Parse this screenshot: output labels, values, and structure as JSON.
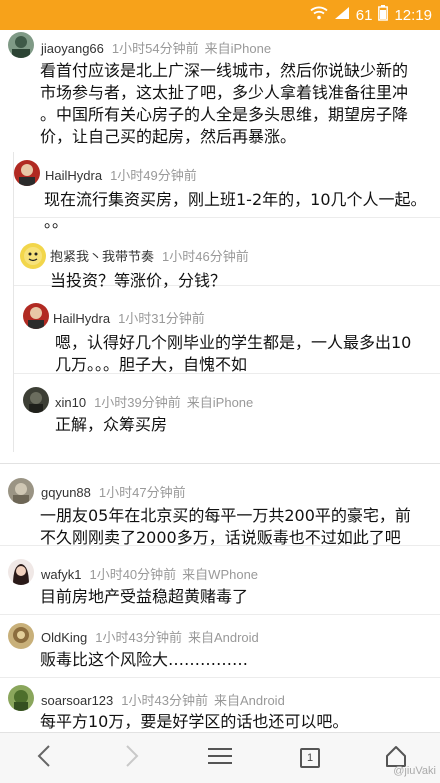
{
  "status_bar": {
    "signal_text": "61",
    "time": "12:19"
  },
  "comments": [
    {
      "user": "jiaoyang66",
      "time": "1小时54分钟前",
      "source": "来自iPhone",
      "lines": [
        "看首付应该是北上广深一线城市，然后你说缺少新的",
        "市场参与者，这太扯了吧，多少人拿着钱准备往里冲",
        "。中国所有关心房子的人全是多头思维，期望房子降",
        "价，让自己买的起房，然后再暴涨。"
      ]
    },
    {
      "user": "HailHydra",
      "time": "1小时49分钟前",
      "source": "",
      "lines": [
        "现在流行集资买房，刚上班1-2年的，10几个人一起。",
        "。。"
      ]
    },
    {
      "user": "抱紧我丶我带节奏",
      "time": "1小时46分钟前",
      "source": "",
      "lines": [
        "当投资？等涨价，分钱？"
      ]
    },
    {
      "user": "HailHydra",
      "time": "1小时31分钟前",
      "source": "",
      "lines": [
        "嗯，认得好几个刚毕业的学生都是，一人最多出10",
        "几万。。。胆子大，自愧不如"
      ]
    },
    {
      "user": "xin10",
      "time": "1小时39分钟前",
      "source": "来自iPhone",
      "lines": [
        "正解，众筹买房"
      ]
    },
    {
      "user": "gqyun88",
      "time": "1小时47分钟前",
      "source": "",
      "lines": [
        "一朋友05年在北京买的每平一万共200平的豪宅，前",
        "不久刚刚卖了2000多万，话说贩毒也不过如此了吧"
      ]
    },
    {
      "user": "wafyk1",
      "time": "1小时40分钟前",
      "source": "来自WPhone",
      "lines": [
        "目前房地产受益稳超黄赌毒了"
      ]
    },
    {
      "user": "OldKing",
      "time": "1小时43分钟前",
      "source": "来自Android",
      "lines": [
        "贩毒比这个风险大……………"
      ]
    },
    {
      "user": "soarsoar123",
      "time": "1小时43分钟前",
      "source": "来自Android",
      "lines": [
        "每平方10万，要是好学区的话也还可以吧。"
      ]
    }
  ],
  "bottom_bar": {
    "tab_count": "1"
  },
  "watermark": "@jiuVaki",
  "colors": {
    "accent": "#f7a21a",
    "meta": "#999999",
    "text": "#111111"
  }
}
